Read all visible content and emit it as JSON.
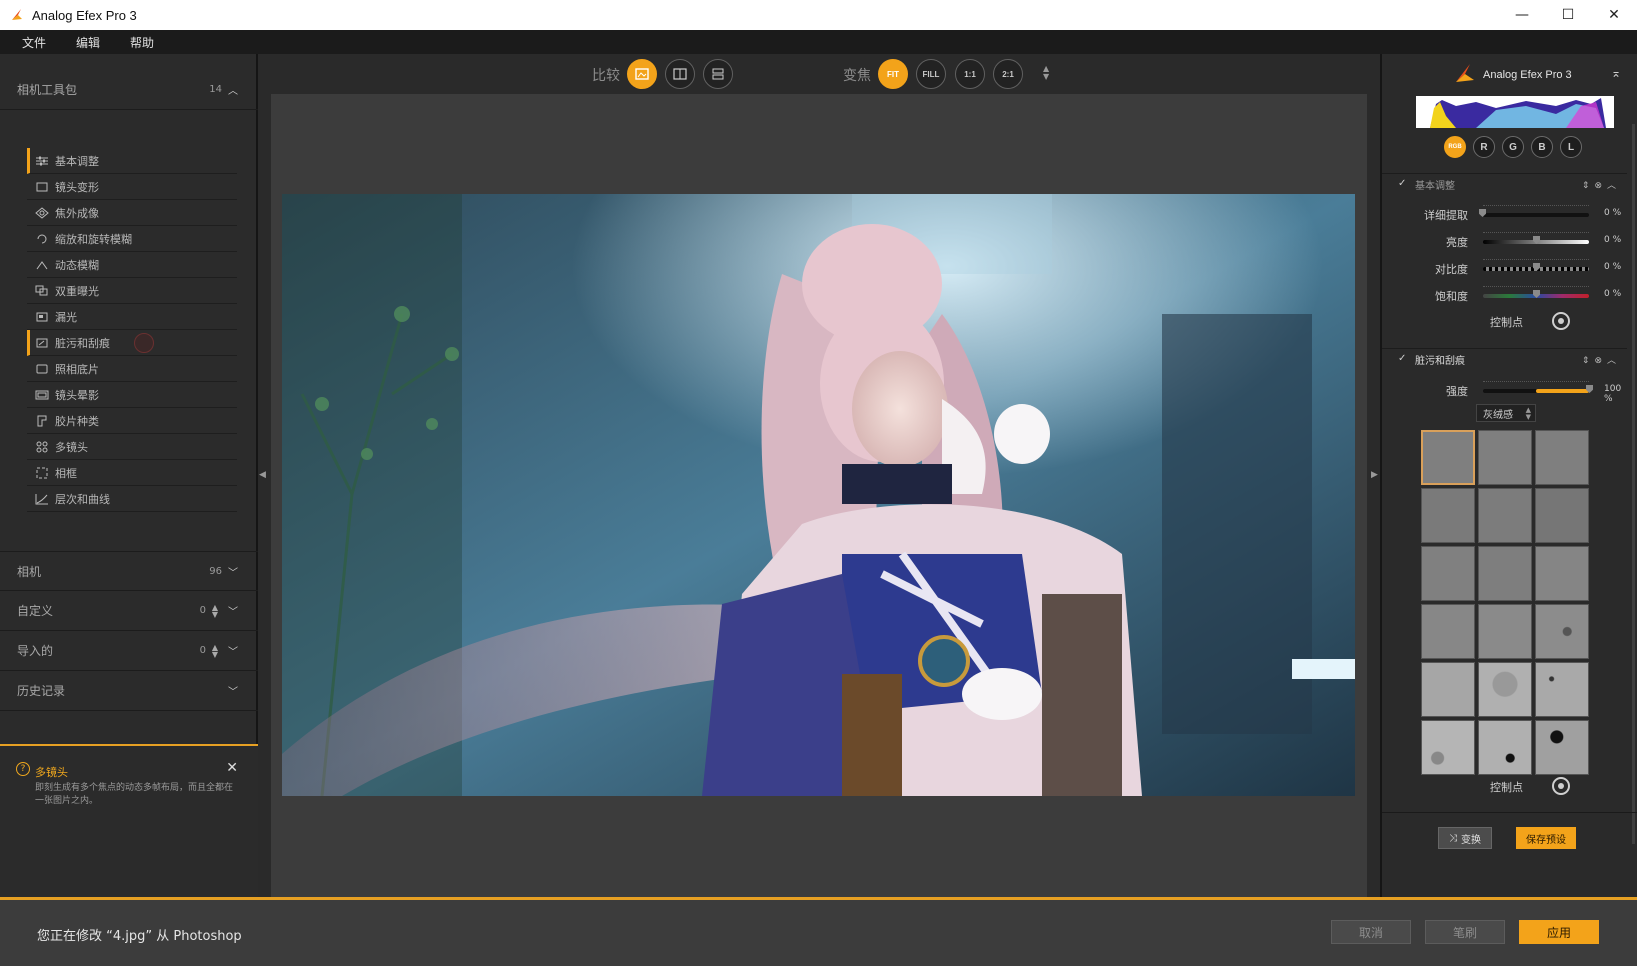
{
  "window": {
    "title": "Analog Efex Pro 3",
    "controls": [
      "—",
      "☐",
      "✕"
    ]
  },
  "menu": [
    "文件",
    "编辑",
    "帮助"
  ],
  "left_panel": {
    "toolkit": {
      "label": "相机工具包",
      "count": "14"
    },
    "tools": [
      {
        "label": "基本调整",
        "icon": "sliders-icon",
        "active": true
      },
      {
        "label": "镜头变形",
        "icon": "lens-distortion-icon"
      },
      {
        "label": "焦外成像",
        "icon": "bokeh-icon"
      },
      {
        "label": "缩放和旋转模糊",
        "icon": "rotate-blur-icon"
      },
      {
        "label": "动态模糊",
        "icon": "motion-blur-icon"
      },
      {
        "label": "双重曝光",
        "icon": "double-exposure-icon"
      },
      {
        "label": "漏光",
        "icon": "light-leak-icon"
      },
      {
        "label": "脏污和刮痕",
        "icon": "dirt-scratch-icon",
        "active": true
      },
      {
        "label": "照相底片",
        "icon": "film-plate-icon"
      },
      {
        "label": "镜头晕影",
        "icon": "vignette-icon"
      },
      {
        "label": "胶片种类",
        "icon": "film-type-icon"
      },
      {
        "label": "多镜头",
        "icon": "multi-lens-icon"
      },
      {
        "label": "相框",
        "icon": "frame-icon"
      },
      {
        "label": "层次和曲线",
        "icon": "curves-icon"
      }
    ],
    "camera": {
      "label": "相机",
      "count": "96"
    },
    "custom": {
      "label": "自定义",
      "count": "0"
    },
    "imported": {
      "label": "导入的",
      "count": "0"
    },
    "history": {
      "label": "历史记录"
    },
    "help": {
      "title": "多镜头",
      "text": "即刻生成有多个焦点的动态多帧布局，而且全都在一张图片之内。"
    }
  },
  "toolbar": {
    "compare_label": "比较",
    "zoom_label": "变焦",
    "zoom_buttons": [
      "FIT",
      "FILL",
      "1:1",
      "2:1"
    ]
  },
  "right_panel": {
    "app_name": "Analog Efex Pro 3",
    "channels": [
      "RGB",
      "R",
      "G",
      "B",
      "L"
    ],
    "basic": {
      "title": "基本调整",
      "sliders": [
        {
          "label": "详细提取",
          "value": "0 %"
        },
        {
          "label": "亮度",
          "value": "0 %"
        },
        {
          "label": "对比度",
          "value": "0 %"
        },
        {
          "label": "饱和度",
          "value": "0 %"
        }
      ],
      "control_point": "控制点"
    },
    "dirt": {
      "title": "脏污和刮痕",
      "strength_label": "强度",
      "strength_value": "100 %",
      "strength": 1.0,
      "preset": "灰绒感",
      "control_point": "控制点"
    },
    "shuffle_label": "变换",
    "save_preset_label": "保存预设"
  },
  "bottom": {
    "message": "您正在修改 “4.jpg” 从 Photoshop",
    "cancel": "取消",
    "brush": "笔刷",
    "apply": "应用"
  },
  "colors": {
    "accent": "#f3a31a"
  }
}
